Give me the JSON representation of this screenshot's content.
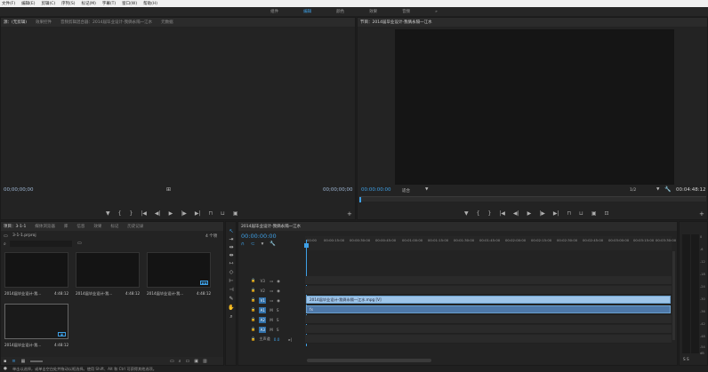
{
  "menu": [
    "文件(F)",
    "编辑(E)",
    "剪辑(C)",
    "序列(S)",
    "标记(M)",
    "字幕(T)",
    "窗口(W)",
    "帮助(H)"
  ],
  "workspaces": [
    {
      "label": "组件",
      "active": false
    },
    {
      "label": "编辑",
      "active": true
    },
    {
      "label": "颜色",
      "active": false
    },
    {
      "label": "效果",
      "active": false
    },
    {
      "label": "音频",
      "active": false
    },
    {
      "label": "»",
      "active": false
    }
  ],
  "source_panel": {
    "tabs": [
      "源：(无剪辑)",
      "效果控件",
      "音频剪辑混合器：2014届毕业设计-我俩永隔一江水",
      "元数据"
    ],
    "tc_left": "00;00;00;00",
    "tc_right": "00;00;00;00"
  },
  "program_panel": {
    "tab": "节目：2014届毕业设计-我俩永隔一江水",
    "tc_left": "00:00:00:00",
    "fit": "适合",
    "ratio": "1/2",
    "tc_right": "00:04:48:12"
  },
  "project_panel": {
    "tabs": [
      "项目：3-1-1",
      "媒体浏览器",
      "库",
      "信息",
      "效果",
      "标记",
      "历史记录"
    ],
    "project_file": "3-1-1.prproj",
    "item_count": "4 个项",
    "items": [
      {
        "label": "2014届毕业设计-我...",
        "duration": "4:48:12",
        "badge": ""
      },
      {
        "label": "2014届毕业设计-我...",
        "duration": "4:48:12",
        "badge": ""
      },
      {
        "label": "2014届毕业设计-我...",
        "duration": "4:48:12",
        "badge": "▣▣"
      },
      {
        "label": "2014届毕业设计-我...",
        "duration": "4:48:12",
        "badge": "▣"
      }
    ]
  },
  "timeline": {
    "tab": "2014届毕业设计-我俩永隔一江水",
    "timecode": "00:00:00:00",
    "ruler": [
      "00:00",
      "00:00:15:00",
      "00:00:30:00",
      "00:00:45:00",
      "00:01:00:00",
      "00:01:15:00",
      "00:01:30:00",
      "00:01:45:00",
      "00:02:00:00",
      "00:02:15:00",
      "00:02:30:00",
      "00:02:45:00",
      "00:03:00:00",
      "00:03:15:00",
      "00:03:30:00"
    ],
    "tracks": [
      {
        "name": "V3",
        "target": false,
        "kind": "video"
      },
      {
        "name": "V2",
        "target": false,
        "kind": "video"
      },
      {
        "name": "V1",
        "target": true,
        "kind": "video"
      },
      {
        "name": "A1",
        "target": true,
        "kind": "audio"
      },
      {
        "name": "A2",
        "target": true,
        "kind": "audio"
      },
      {
        "name": "A3",
        "target": true,
        "kind": "audio"
      }
    ],
    "master_label": "主声道",
    "master_value": "0.0",
    "video_clip": "2014届毕业设计-我俩永隔一江水.mpg [V]",
    "audio_clip": "fx"
  },
  "meter": {
    "labels": [
      "0",
      "-6",
      "-12",
      "-18",
      "-24",
      "-30",
      "-36",
      "-42",
      "-48",
      "-54",
      "dB"
    ],
    "solo": "S S"
  },
  "status": "单击以选择，或单击空白处并拖动以框选择。使用 Shift、Alt 和 Ctrl 可获得其他选项。"
}
